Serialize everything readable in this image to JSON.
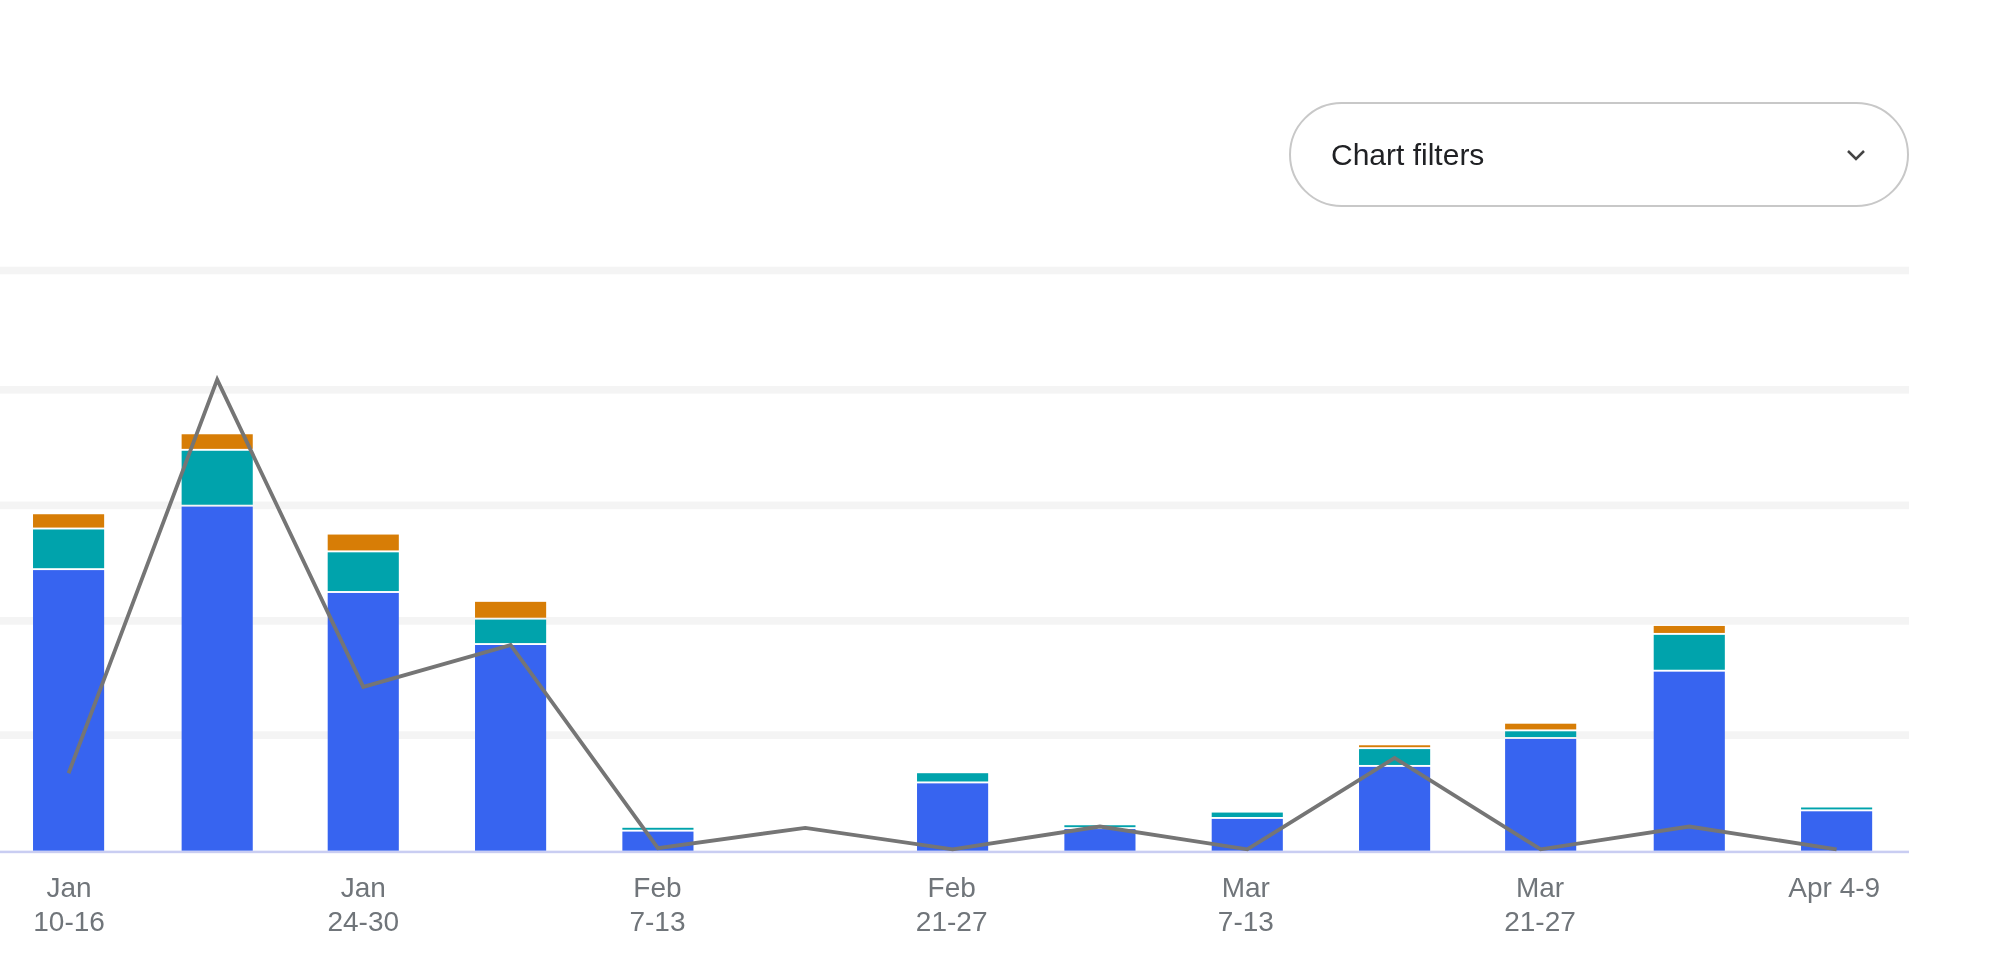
{
  "chart_filters": {
    "label": "Chart filters"
  },
  "chart": {
    "x_labels": [
      {
        "lines": [
          "Jan",
          "10-16"
        ]
      },
      {
        "lines": [
          "Jan",
          "24-30"
        ]
      },
      {
        "lines": [
          "Feb",
          "7-13"
        ]
      },
      {
        "lines": [
          "Feb",
          "21-27"
        ]
      },
      {
        "lines": [
          "Mar",
          "7-13"
        ]
      },
      {
        "lines": [
          "Mar",
          "21-27"
        ]
      },
      {
        "lines": [
          "Apr 4-9"
        ]
      }
    ]
  }
}
